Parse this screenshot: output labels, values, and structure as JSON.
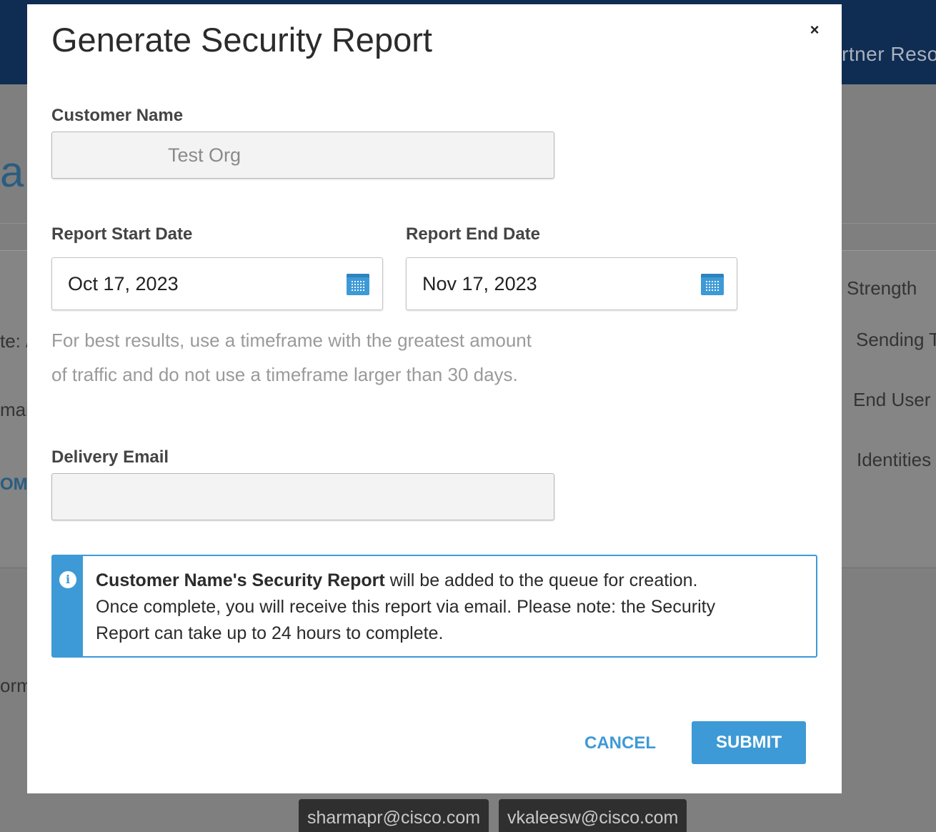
{
  "background": {
    "header_title": "rtner Reso",
    "page_heading_fragment": "a",
    "left_fragments": [
      "te: /",
      "mai",
      "OM",
      "orm"
    ],
    "right_labels": [
      "l Strength",
      "Sending T",
      "End User",
      "Identities"
    ],
    "email_chips": [
      "sharmapr@cisco.com",
      "vkaleesw@cisco.com"
    ]
  },
  "modal": {
    "title": "Generate Security Report",
    "close_glyph": "×",
    "customer_name": {
      "label": "Customer Name",
      "value": "Test Org"
    },
    "start_date": {
      "label": "Report Start Date",
      "value": "Oct 17, 2023"
    },
    "end_date": {
      "label": "Report End Date",
      "value": "Nov 17, 2023"
    },
    "hint": "For best results, use a timeframe with the greatest amount of traffic and do not use a timeframe larger than 30 days.",
    "delivery_email": {
      "label": "Delivery Email",
      "value": "",
      "placeholder": ""
    },
    "info": {
      "icon_glyph": "i",
      "bold": "Customer Name's Security Report",
      "text": " will be added to the queue for creation. Once complete, you will receive this report via email. Please note: the Security Report can take up to 24 hours to complete."
    },
    "buttons": {
      "cancel": "CANCEL",
      "submit": "SUBMIT"
    }
  },
  "colors": {
    "accent": "#3d9ad6",
    "header_bg": "#0f2c52",
    "overlay": "#808080"
  }
}
